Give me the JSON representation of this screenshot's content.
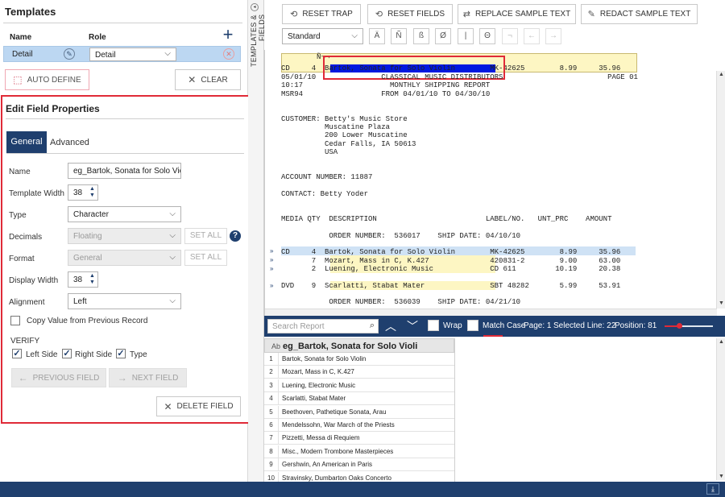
{
  "templates": {
    "title": "Templates",
    "col_name": "Name",
    "col_role": "Role",
    "row": {
      "name": "Detail",
      "role": "Detail"
    },
    "auto_define_label": "AUTO DEFINE",
    "clear_label": "CLEAR"
  },
  "edit": {
    "title": "Edit Field Properties",
    "tab_general": "General",
    "tab_advanced": "Advanced",
    "name_label": "Name",
    "name_value": "eg_Bartok, Sonata for Solo Vio",
    "template_width_label": "Template Width",
    "template_width_value": "38",
    "type_label": "Type",
    "type_value": "Character",
    "decimals_label": "Decimals",
    "decimals_value": "Floating",
    "format_label": "Format",
    "format_value": "General",
    "set_all_label": "SET ALL",
    "display_width_label": "Display Width",
    "display_width_value": "38",
    "alignment_label": "Alignment",
    "alignment_value": "Left",
    "copy_value_label": "Copy Value from Previous Record",
    "verify_label": "VERIFY",
    "left_side_label": "Left Side",
    "right_side_label": "Right Side",
    "type_check_label": "Type",
    "prev_field_label": "PREVIOUS FIELD",
    "next_field_label": "NEXT FIELD",
    "delete_field_label": "DELETE FIELD"
  },
  "strip": {
    "label": "TEMPLATES & FIELDS"
  },
  "toolbar": {
    "reset_trap": "RESET TRAP",
    "reset_fields": "RESET FIELDS",
    "replace_sample": "REPLACE SAMPLE TEXT",
    "redact_sample": "REDACT SAMPLE TEXT",
    "font_select": "Standard",
    "special_chars": [
      "Ä",
      "Ñ",
      "ß",
      "Ø",
      "|",
      "Θ",
      "¬",
      "←",
      "→"
    ]
  },
  "report": {
    "ruler_top": "Ñ¬¬",
    "ruler_line": "CD     4  Bartok, Sonata for Solo Violin        MK-42625        8.99     35.96",
    "lines": [
      "05/01/10               CLASSICAL MUSIC DISTRIBUTORS                        PAGE 01",
      "10:17                    MONTHLY SHIPPING REPORT",
      "MSR94                  FROM 04/01/10 TO 04/30/10",
      "",
      "",
      "CUSTOMER: Betty's Music Store",
      "          Muscatine Plaza",
      "          200 Lower Muscatine",
      "          Cedar Falls, IA 50613",
      "          USA",
      "",
      "",
      "ACCOUNT NUMBER: 11887",
      "",
      "CONTACT: Betty Yoder",
      "",
      "",
      "MEDIA QTY  DESCRIPTION                         LABEL/NO.   UNT_PRC    AMOUNT",
      "",
      "           ORDER NUMBER:  536017    SHIP DATE: 04/10/10",
      "",
      "CD     4  Bartok, Sonata for Solo Violin        MK-42625        8.99     35.96",
      "       7  Mozart, Mass in C, K.427              420831-2        9.00     63.00",
      "       2  Luening, Electronic Music             CD 611         10.19     20.38",
      "",
      "DVD    9  Scarlatti, Stabat Mater               SBT 48282       5.99     53.91",
      "",
      "           ORDER NUMBER:  536039    SHIP DATE: 04/21/10"
    ],
    "marker": "»"
  },
  "search": {
    "placeholder": "Search Report",
    "wrap_label": "Wrap",
    "match_case_label": "Match Case",
    "page_label": "Page: 1",
    "selected_line_label": "Selected Line: 22",
    "position_label": "Position: 81",
    "zoom_level": 0.3
  },
  "grid": {
    "type_badge": "Ab",
    "header": "eg_Bartok, Sonata for Solo Violi",
    "rows": [
      {
        "n": "1",
        "v": "Bartok, Sonata for Solo Violin"
      },
      {
        "n": "2",
        "v": "Mozart, Mass in C, K.427"
      },
      {
        "n": "3",
        "v": "Luening, Electronic Music"
      },
      {
        "n": "4",
        "v": "Scarlatti, Stabat Mater"
      },
      {
        "n": "5",
        "v": "Beethoven, Pathetique Sonata, Arau"
      },
      {
        "n": "6",
        "v": "Mendelssohn, War March of the Priests"
      },
      {
        "n": "7",
        "v": "Pizzetti, Messa di Requiem"
      },
      {
        "n": "8",
        "v": "Misc., Modern Trombone Masterpieces"
      },
      {
        "n": "9",
        "v": "Gershwin, An American in Paris"
      },
      {
        "n": "10",
        "v": "Stravinsky, Dumbarton Oaks Concerto"
      }
    ]
  },
  "colors": {
    "accent": "#1f3f6e",
    "highlight_red": "#e02a37",
    "yellow": "#fdf6c3",
    "selection": "#0019e0"
  }
}
